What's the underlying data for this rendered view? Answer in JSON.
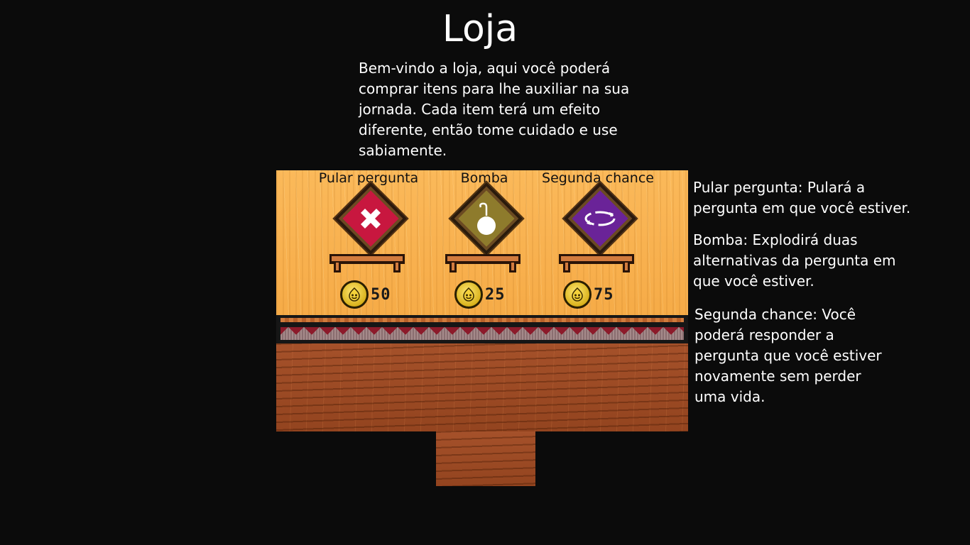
{
  "shop": {
    "title": "Loja",
    "intro": "Bem-vindo a loja, aqui você poderá comprar itens para lhe auxiliar na sua jornada. Cada item terá um efeito diferente, então tome cuidado e use sabiamente."
  },
  "items": [
    {
      "name": "Pular pergunta",
      "price": "50",
      "icon": "red-x-icon",
      "color": "#c8173f"
    },
    {
      "name": "Bomba",
      "price": "25",
      "icon": "bomb-icon",
      "color": "#8e7b2c"
    },
    {
      "name": "Segunda chance",
      "price": "75",
      "icon": "second-chance-icon",
      "color": "#6a2398"
    }
  ],
  "currency": {
    "icon": "coin-icon",
    "color": "#e6c02a"
  },
  "descriptions": [
    "Pular pergunta: Pulará a pergunta em que você estiver.",
    "Bomba: Explodirá duas alternativas da pergunta em que você estiver.",
    "Segunda chance: Você poderá responder a pergunta que você estiver novamente sem perder uma vida."
  ]
}
